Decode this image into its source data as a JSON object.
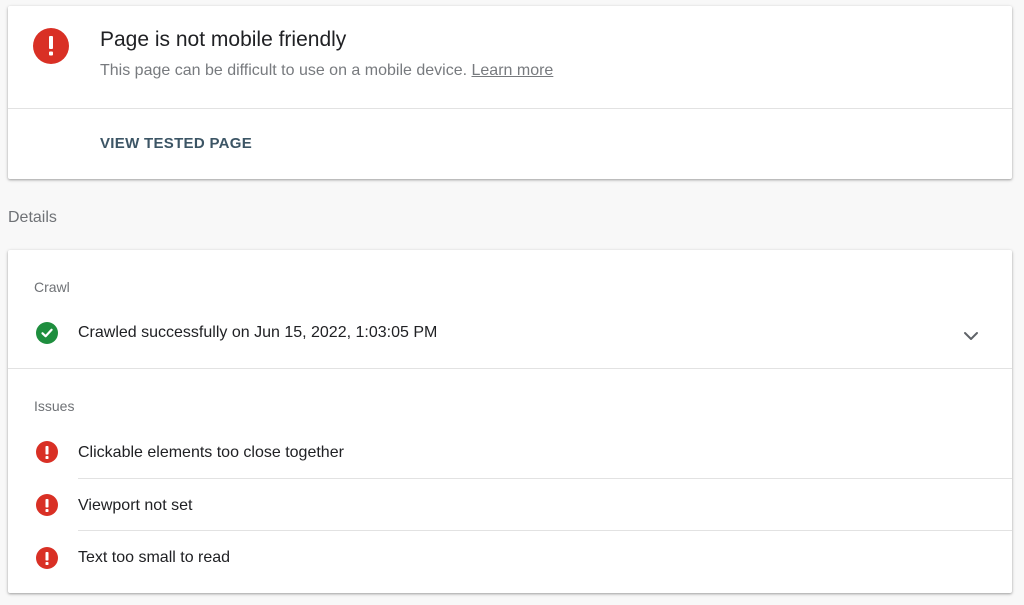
{
  "summary": {
    "title": "Page is not mobile friendly",
    "subtitle": "This page can be difficult to use on a mobile device.",
    "learn_more": "Learn more",
    "view_button": "VIEW TESTED PAGE",
    "status_icon": "error-icon",
    "status_color": "#d93025"
  },
  "details": {
    "heading": "Details",
    "crawl": {
      "label": "Crawl",
      "status": "Crawled successfully on Jun 15, 2022, 1:03:05 PM",
      "status_icon": "check-circle-icon",
      "status_color": "#1e8e3e",
      "expand_icon": "chevron-down-icon"
    },
    "issues": {
      "label": "Issues",
      "items": [
        "Clickable elements too close together",
        "Viewport not set",
        "Text too small to read"
      ],
      "item_icon": "error-icon"
    }
  }
}
